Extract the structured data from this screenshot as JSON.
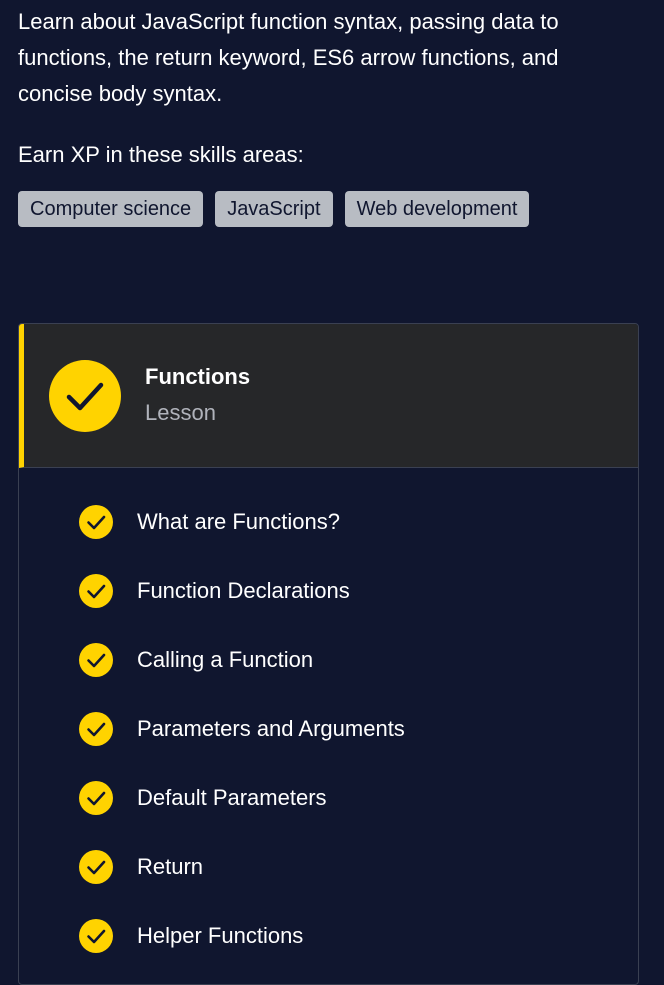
{
  "description": "Learn about JavaScript function syntax, passing data to functions, the return keyword, ES6 arrow functions, and concise body syntax.",
  "skills": {
    "heading": "Earn XP in these skills areas:",
    "tags": [
      "Computer science",
      "JavaScript",
      "Web development"
    ]
  },
  "lesson": {
    "title": "Functions",
    "type": "Lesson",
    "status_icon": "check-circle-icon",
    "items": [
      {
        "label": "What are Functions?",
        "completed": true
      },
      {
        "label": "Function Declarations",
        "completed": true
      },
      {
        "label": "Calling a Function",
        "completed": true
      },
      {
        "label": "Parameters and Arguments",
        "completed": true
      },
      {
        "label": "Default Parameters",
        "completed": true
      },
      {
        "label": "Return",
        "completed": true
      },
      {
        "label": "Helper Functions",
        "completed": true
      }
    ]
  },
  "colors": {
    "background": "#10162f",
    "accent": "#ffd300",
    "header_bg": "#262729",
    "tag_bg": "#b8bcc3"
  }
}
